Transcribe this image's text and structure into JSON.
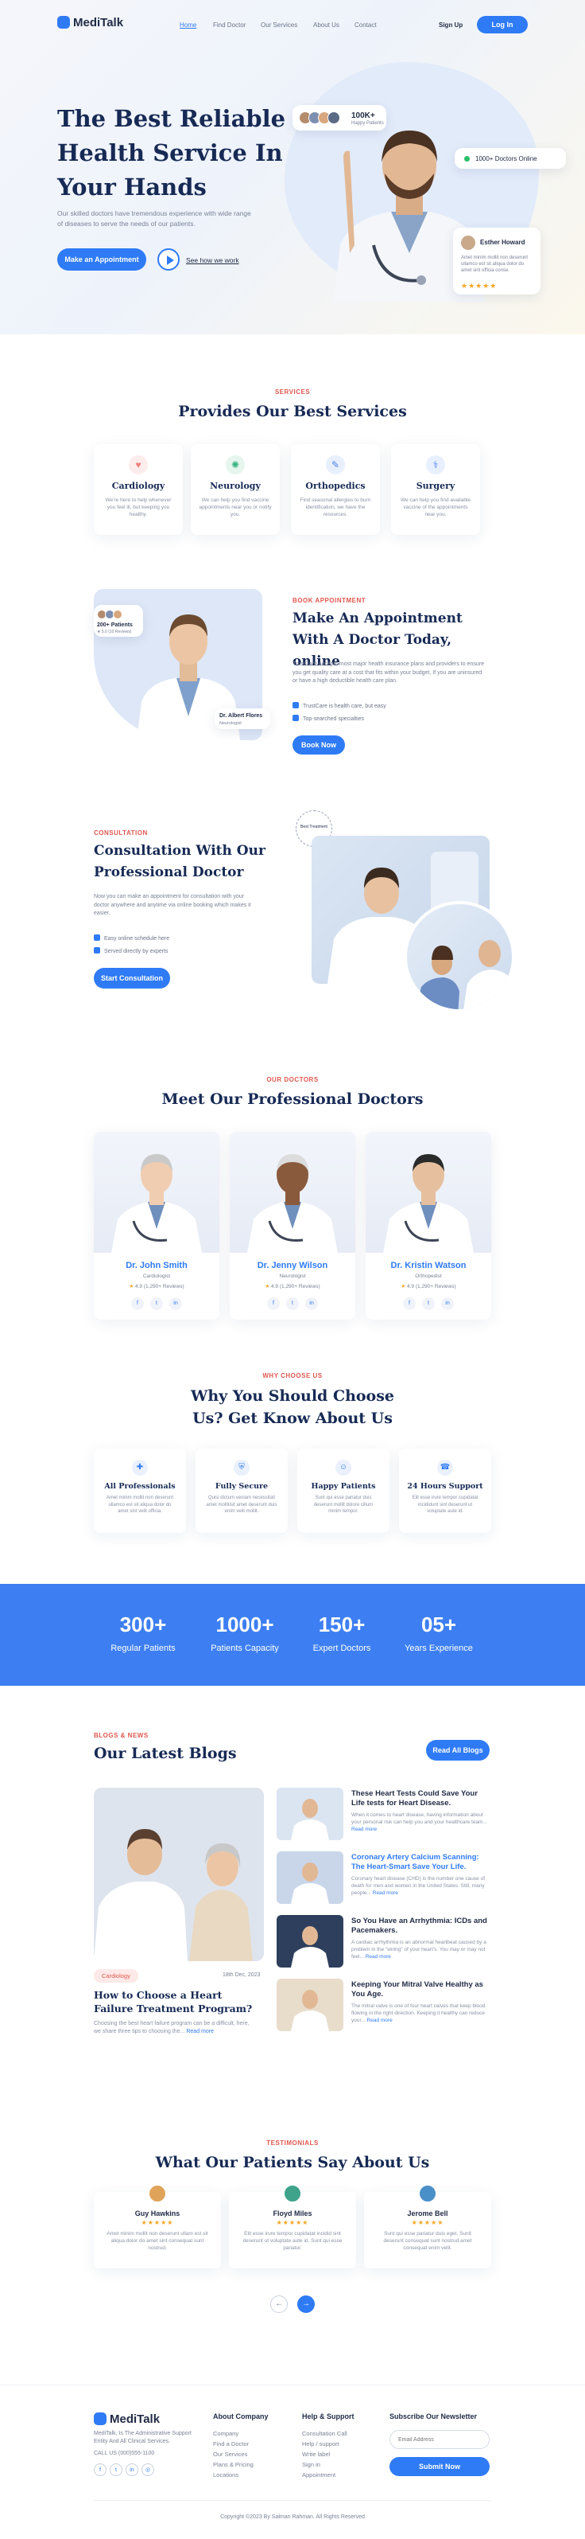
{
  "nav": {
    "brand": "MediTalk",
    "links": [
      "Home",
      "Find Doctor",
      "Our Services",
      "About Us",
      "Contact"
    ],
    "signup": "Sign Up",
    "login": "Log In"
  },
  "hero": {
    "title": "The Best Reliable Health Service In Your Hands",
    "desc": "Our skilled doctors have tremendous experience with wide range of diseases to serve the needs of our patients.",
    "cta": "Make an Appointment",
    "how": "See how we work",
    "patients_count": "100K+",
    "patients_label": "Happy Patients",
    "online": "1000+ Doctors Online",
    "review_name": "Esther Howard",
    "review_text": "Amet minim mollit non deserunt ullamco est sit aliqua dolor do amet sint officia conse.",
    "stars": "★★★★★"
  },
  "services": {
    "label": "SERVICES",
    "title": "Provides Our Best Services",
    "items": [
      {
        "name": "Cardiology",
        "desc": "We're here to help whenever you feel ill, but keeping you healthy.",
        "icon": "heart-icon",
        "color": "#f27c7c",
        "bg": "#fdecec"
      },
      {
        "name": "Neurology",
        "desc": "We can help you find vaccine appointments near you or notify you.",
        "icon": "brain-icon",
        "color": "#35b37e",
        "bg": "#e6f6ee"
      },
      {
        "name": "Orthopedics",
        "desc": "Find seasonal allergies to burn identification, we have the resources.",
        "icon": "bone-icon",
        "color": "#4a84f0",
        "bg": "#e8effd"
      },
      {
        "name": "Surgery",
        "desc": "We can help you find available vaccine of the appointments near you.",
        "icon": "lungs-icon",
        "color": "#4a84f0",
        "bg": "#e8effd"
      }
    ]
  },
  "book": {
    "label": "BOOK APPOINTMENT",
    "title": "Make An Appointment With A Doctor Today, online",
    "desc": "TrustCare accepts most major health insurance plans and providers to ensure you get quality care at a cost that fits within your budget. If you are uninsured or have a high deductible health care plan.",
    "checks": [
      "TrustCare is health care, but easy",
      "Top-searched specialties"
    ],
    "cta": "Book Now",
    "patients": "200+ Patients",
    "rating": "★ 5.0 (10 Reviews)",
    "doc_name": "Dr. Albert Flores",
    "doc_role": "Neurologist"
  },
  "consult": {
    "label": "CONSULTATION",
    "title": "Consultation With Our Professional Doctor",
    "desc": "Now you can make an appointment for consultation with your doctor anywhere and anytime via online booking which makes it easier.",
    "checks": [
      "Easy online schedule here",
      "Served directly by experts"
    ],
    "cta": "Start Consultation",
    "badge": "Best Treatment"
  },
  "doctors": {
    "label": "OUR DOCTORS",
    "title": "Meet Our Professional Doctors",
    "items": [
      {
        "name": "Dr. John Smith",
        "role": "Cardiologist",
        "rating": "4.9 (1,290+ Reviews)"
      },
      {
        "name": "Dr. Jenny Wilson",
        "role": "Neurologist",
        "rating": "4.9 (1,290+ Reviews)"
      },
      {
        "name": "Dr. Kristin Watson",
        "role": "Orthopedist",
        "rating": "4.9 (1,290+ Reviews)"
      }
    ]
  },
  "why": {
    "label": "WHY CHOOSE US",
    "title": "Why You Should Choose Us? Get Know About Us",
    "items": [
      {
        "name": "All Professionals",
        "desc": "Amet minim mollit non deserunt ullamco est sit aliqua dolor do amet sint velit officia."
      },
      {
        "name": "Fully Secure",
        "desc": "Quisi dictum veniam necessitati amet mollitisit amet deserunt duis enim velit mollit."
      },
      {
        "name": "Happy Patients",
        "desc": "Sunt qui esse pariatur duis deserunt mollit dolore cillum minim tempor."
      },
      {
        "name": "24 Hours Support",
        "desc": "Elit esse irure tempor cupidatat incididunt sint deserunt ut voluptate aute id."
      }
    ]
  },
  "stats": [
    {
      "value": "300+",
      "label": "Regular Patients"
    },
    {
      "value": "1000+",
      "label": "Patients Capacity"
    },
    {
      "value": "150+",
      "label": "Expert Doctors"
    },
    {
      "value": "05+",
      "label": "Years Experience"
    }
  ],
  "blogs": {
    "label": "BLOGS & NEWS",
    "title": "Our Latest Blogs",
    "read_all": "Read All Blogs",
    "main_tag": "Cardiology",
    "main_date": "18th Dec, 2023",
    "main_title": "How to Choose a Heart Failure Treatment Program?",
    "main_desc": "Choosing the best heart failure program can be a difficult, here, we share three tips to choosing the...",
    "read_more": "Read more",
    "items": [
      {
        "title": "These Heart Tests Could Save Your Life tests for Heart Disease.",
        "desc": "When it comes to heart disease, having information about your personal risk can help you and your healthcare team..."
      },
      {
        "title": "Coronary Artery Calcium Scanning: The Heart-Smart Save Your Life.",
        "desc": "Coronary heart disease (CHD) is the number one cause of death for men and women in the United States. Still, many people..."
      },
      {
        "title": "So You Have an Arrhythmia: ICDs and Pacemakers.",
        "desc": "A cardiac arrhythmia is an abnormal heartbeat caused by a problem in the \"wiring\" of your heart's. You may or may not feel..."
      },
      {
        "title": "Keeping Your Mitral Valve Healthy as You Age.",
        "desc": "The mitral valve is one of four heart valves that keep blood flowing in the right direction. Keeping it healthy can reduce your..."
      }
    ]
  },
  "testimonials": {
    "label": "TESTIMONIALS",
    "title": "What Our Patients Say About Us",
    "items": [
      {
        "name": "Guy Hawkins",
        "text": "Amet minim mollit non deserunt ullam est sit aliqua dolor do amet sint consequat sunt nostrud."
      },
      {
        "name": "Floyd Miles",
        "text": "Elit esse irure tempor cupidatat incidid sint deserunt ut voluptate aute id. Sunt qui esse pariatur."
      },
      {
        "name": "Jerome Bell",
        "text": "Sunt qui esse pariatur duis eget. Sunit deserunt consequat sunt nostrud amet consequat enim velit."
      }
    ],
    "stars": "★★★★★"
  },
  "footer": {
    "brand": "MediTalk",
    "about": "MediTalk, Is The Administrative Support Entity And All Clinical Services.",
    "phone": "CALL US (000)555-1100",
    "company_title": "About Company",
    "company": [
      "Company",
      "Find a Doctor",
      "Our Services",
      "Plans & Pricing",
      "Locations"
    ],
    "help_title": "Help & Support",
    "help": [
      "Consultation Call",
      "Help / support",
      "Write label",
      "Sign in",
      "Appointment"
    ],
    "news_title": "Subscribe Our Newsletter",
    "email_placeholder": "Email Address",
    "subscribe": "Submit Now",
    "copyright": "Copyright ©2023 By Salman Rahman. All Rights Reserved"
  }
}
